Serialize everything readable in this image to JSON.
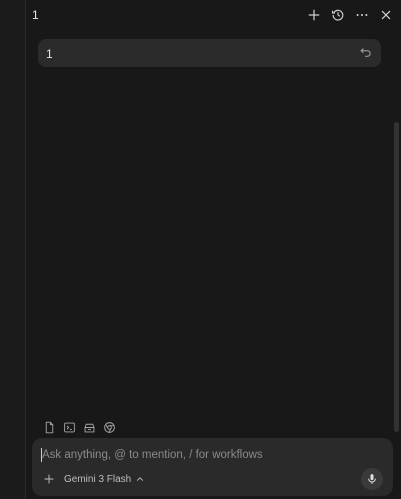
{
  "header": {
    "title": "1",
    "icons": [
      "plus-icon",
      "history-icon",
      "more-icon",
      "close-icon"
    ]
  },
  "conversation": {
    "messages": [
      {
        "text": "1",
        "action_icon": "undo-icon"
      }
    ]
  },
  "context_tools": {
    "icons": [
      "file-icon",
      "terminal-icon",
      "archive-icon",
      "browser-icon"
    ]
  },
  "composer": {
    "placeholder": "Ask anything, @ to mention, / for workflows",
    "value": "",
    "model": "Gemini 3 Flash",
    "add_icon": "plus-icon",
    "model_chevron_icon": "chevron-up-icon",
    "voice_icon": "microphone-icon"
  },
  "colors": {
    "background": "#181818",
    "bubble": "#2b2b2b",
    "composer": "#2a2a2a",
    "text": "#e6e6e6",
    "muted": "#8a8a8a"
  }
}
